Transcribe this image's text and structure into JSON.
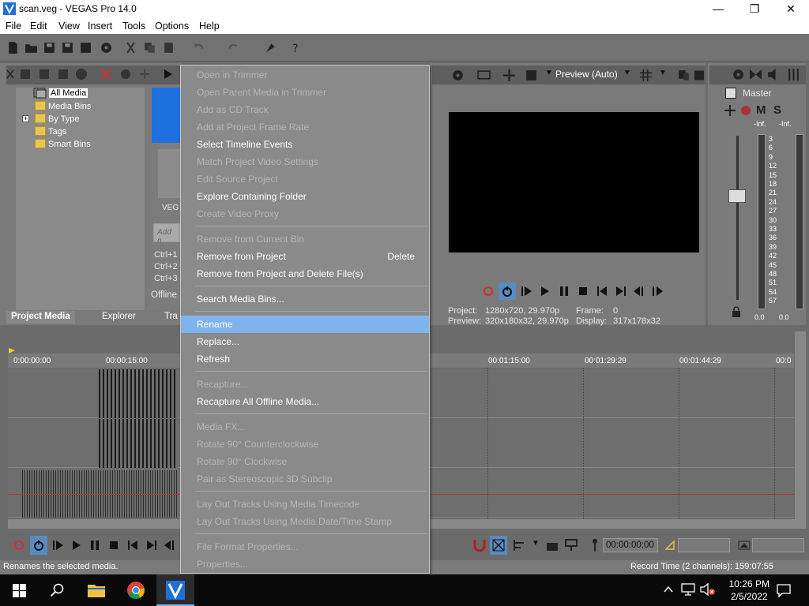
{
  "window": {
    "title": "scan.veg - VEGAS Pro 14.0",
    "controls": {
      "minimize": "—",
      "maximize": "❐",
      "close": "✕"
    }
  },
  "menubar": [
    "File",
    "Edit",
    "View",
    "Insert",
    "Tools",
    "Options",
    "Help"
  ],
  "project_media": {
    "tree": [
      "All Media",
      "Media Bins",
      "By Type",
      "Tags",
      "Smart Bins"
    ],
    "selected": "All Media",
    "media_label": "VEG",
    "search_placeholder": "Add n",
    "shortcuts": [
      "Ctrl+1",
      "Ctrl+2",
      "Ctrl+3"
    ],
    "offline_label": "Offline",
    "tabs": [
      "Project Media",
      "Explorer",
      "Tra"
    ],
    "active_tab": "Project Media"
  },
  "preview": {
    "mode_label": "Preview (Auto)",
    "project_label": "Project:",
    "project_value": "1280x720, 29.970p",
    "frame_label": "Frame:",
    "frame_value": "0",
    "preview_label": "Preview:",
    "preview_value": "320x180x32, 29.970p",
    "display_label": "Display:",
    "display_value": "317x178x32"
  },
  "master": {
    "label": "Master",
    "buttons": [
      "M",
      "S"
    ],
    "inf_left": "-Inf.",
    "inf_right": "-Inf.",
    "scale": [
      "3",
      "6",
      "9",
      "12",
      "15",
      "18",
      "21",
      "24",
      "27",
      "30",
      "33",
      "36",
      "39",
      "42",
      "45",
      "48",
      "51",
      "54",
      "57"
    ],
    "readout_left": "0.0",
    "readout_right": "0.0"
  },
  "context_menu": {
    "groups": [
      [
        {
          "label": "Open in Trimmer",
          "enabled": false
        },
        {
          "label": "Open Parent Media in Trimmer",
          "enabled": false
        },
        {
          "label": "Add as CD Track",
          "enabled": false
        },
        {
          "label": "Add at Project Frame Rate",
          "enabled": false
        },
        {
          "label": "Select Timeline Events",
          "enabled": true
        },
        {
          "label": "Match Project Video Settings",
          "enabled": false
        },
        {
          "label": "Edit Source Project",
          "enabled": false
        },
        {
          "label": "Explore Containing Folder",
          "enabled": true
        },
        {
          "label": "Create Video Proxy",
          "enabled": false
        }
      ],
      [
        {
          "label": "Remove from Current Bin",
          "enabled": false
        },
        {
          "label": "Remove from Project",
          "enabled": true,
          "shortcut": "Delete"
        },
        {
          "label": "Remove from Project and Delete File(s)",
          "enabled": true
        }
      ],
      [
        {
          "label": "Search Media Bins...",
          "enabled": true
        }
      ],
      [
        {
          "label": "Rename",
          "enabled": true,
          "highlighted": true
        },
        {
          "label": "Replace...",
          "enabled": true
        },
        {
          "label": "Refresh",
          "enabled": true
        }
      ],
      [
        {
          "label": "Recapture...",
          "enabled": false
        },
        {
          "label": "Recapture All Offline Media...",
          "enabled": true
        }
      ],
      [
        {
          "label": "Media FX...",
          "enabled": false
        },
        {
          "label": "Rotate 90° Counterclockwise",
          "enabled": false
        },
        {
          "label": "Rotate 90° Clockwise",
          "enabled": false
        },
        {
          "label": "Pair as Stereoscopic 3D Subclip",
          "enabled": false
        }
      ],
      [
        {
          "label": "Lay Out Tracks Using Media Timecode",
          "enabled": false
        },
        {
          "label": "Lay Out Tracks Using Media Date/Time Stamp",
          "enabled": false
        }
      ],
      [
        {
          "label": "File Format Properties...",
          "enabled": false
        },
        {
          "label": "Properties...",
          "enabled": false
        }
      ]
    ]
  },
  "timeline": {
    "ruler": [
      "0:00:00:00",
      "00:00:15:00",
      "00:01:15:00",
      "00:01:29:29",
      "00:01:44:29",
      "00:0"
    ],
    "timecode": "00:00:00;00"
  },
  "statusbar": {
    "hint": "Renames the selected media.",
    "record_time": "Record Time (2 channels): 159:07:55"
  },
  "taskbar": {
    "time": "10:26 PM",
    "date": "2/5/2022"
  },
  "colors": {
    "menu_highlight": "#7fb3ee",
    "accent": "#0078d7"
  }
}
